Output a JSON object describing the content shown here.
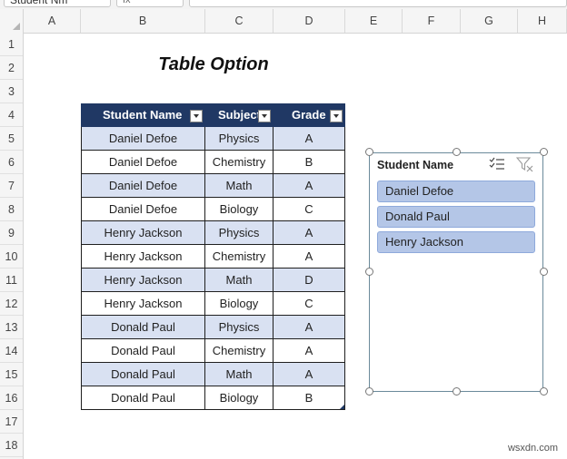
{
  "formula_bar": {
    "name_box": "Student Nm",
    "fx_label": "fx"
  },
  "columns": [
    "A",
    "B",
    "C",
    "D",
    "E",
    "F",
    "G",
    "H"
  ],
  "rows": [
    "1",
    "2",
    "3",
    "4",
    "5",
    "6",
    "7",
    "8",
    "9",
    "10",
    "11",
    "12",
    "13",
    "14",
    "15",
    "16",
    "17",
    "18"
  ],
  "title": "Table Option",
  "table": {
    "headers": [
      "Student Name",
      "Subject",
      "Grade"
    ],
    "rows": [
      [
        "Daniel Defoe",
        "Physics",
        "A"
      ],
      [
        "Daniel Defoe",
        "Chemistry",
        "B"
      ],
      [
        "Daniel Defoe",
        "Math",
        "A"
      ],
      [
        "Daniel Defoe",
        "Biology",
        "C"
      ],
      [
        "Henry Jackson",
        "Physics",
        "A"
      ],
      [
        "Henry Jackson",
        "Chemistry",
        "A"
      ],
      [
        "Henry Jackson",
        "Math",
        "D"
      ],
      [
        "Henry Jackson",
        "Biology",
        "C"
      ],
      [
        "Donald Paul",
        "Physics",
        "A"
      ],
      [
        "Donald Paul",
        "Chemistry",
        "A"
      ],
      [
        "Donald Paul",
        "Math",
        "A"
      ],
      [
        "Donald Paul",
        "Biology",
        "B"
      ]
    ]
  },
  "slicer": {
    "title": "Student Name",
    "items": [
      "Daniel Defoe",
      "Donald Paul",
      "Henry Jackson"
    ],
    "multiselect_icon": "multi-select-icon",
    "clear_icon": "clear-filter-icon"
  },
  "colors": {
    "header_bg": "#203864",
    "band_bg": "#d9e1f2",
    "slicer_item_bg": "#b4c6e7",
    "slicer_border": "#6b8a9a"
  },
  "watermark": "wsxdn.com"
}
